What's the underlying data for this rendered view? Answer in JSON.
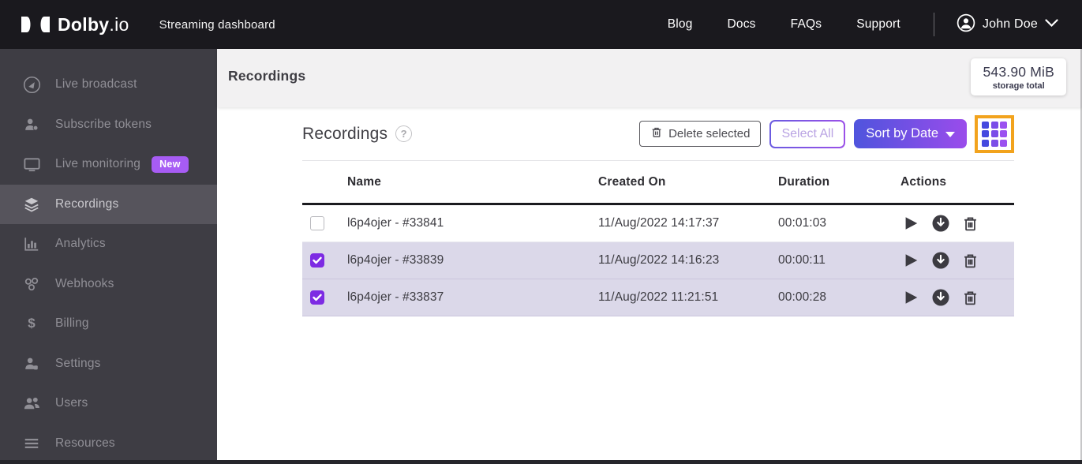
{
  "topbar": {
    "brand_bold": "D",
    "brand_rest": "olby",
    "brand_suffix": ".io",
    "subtitle": "Streaming dashboard",
    "links": {
      "blog": "Blog",
      "docs": "Docs",
      "faqs": "FAQs",
      "support": "Support"
    },
    "user_name": "John Doe"
  },
  "sidebar": {
    "items": [
      {
        "label": "Live broadcast",
        "icon": "broadcast-icon"
      },
      {
        "label": "Subscribe tokens",
        "icon": "subscriber-icon"
      },
      {
        "label": "Live monitoring",
        "icon": "monitor-icon",
        "badge": "New"
      },
      {
        "label": "Recordings",
        "icon": "layers-icon",
        "active": true
      },
      {
        "label": "Analytics",
        "icon": "bar-chart-icon"
      },
      {
        "label": "Webhooks",
        "icon": "webhook-icon"
      },
      {
        "label": "Billing",
        "icon": "dollar-icon",
        "glyph": "$"
      },
      {
        "label": "Settings",
        "icon": "person-gear-icon"
      },
      {
        "label": "Users",
        "icon": "users-icon"
      },
      {
        "label": "Resources",
        "icon": "list-icon"
      }
    ]
  },
  "header": {
    "title": "Recordings",
    "storage_value": "543.90 MiB",
    "storage_label": "storage total"
  },
  "toolbar": {
    "section_title": "Recordings",
    "help_glyph": "?",
    "delete_label": "Delete selected",
    "select_all_label": "Select All",
    "sort_label": "Sort by Date"
  },
  "table": {
    "columns": {
      "name": "Name",
      "created": "Created On",
      "duration": "Duration",
      "actions": "Actions"
    },
    "rows": [
      {
        "checked": false,
        "name": "l6p4ojer - #33841",
        "created": "11/Aug/2022 14:17:37",
        "duration": "00:01:03"
      },
      {
        "checked": true,
        "name": "l6p4ojer - #33839",
        "created": "11/Aug/2022 14:16:23",
        "duration": "00:00:11"
      },
      {
        "checked": true,
        "name": "l6p4ojer - #33837",
        "created": "11/Aug/2022 11:21:51",
        "duration": "00:00:28"
      }
    ]
  },
  "colors": {
    "topbar_bg": "#1a191e",
    "sidebar_bg": "#3e3d44",
    "sidebar_active_bg": "#56545c",
    "accent_purple": "#7d2be3",
    "badge_purple": "#a75cf4",
    "selected_row_bg": "#dbd8e9",
    "sort_gradient_start": "#4f54dd",
    "sort_gradient_end": "#9a4ceb",
    "highlight_orange": "#f2a31d",
    "header_strip_bg": "#f2f1f2"
  }
}
